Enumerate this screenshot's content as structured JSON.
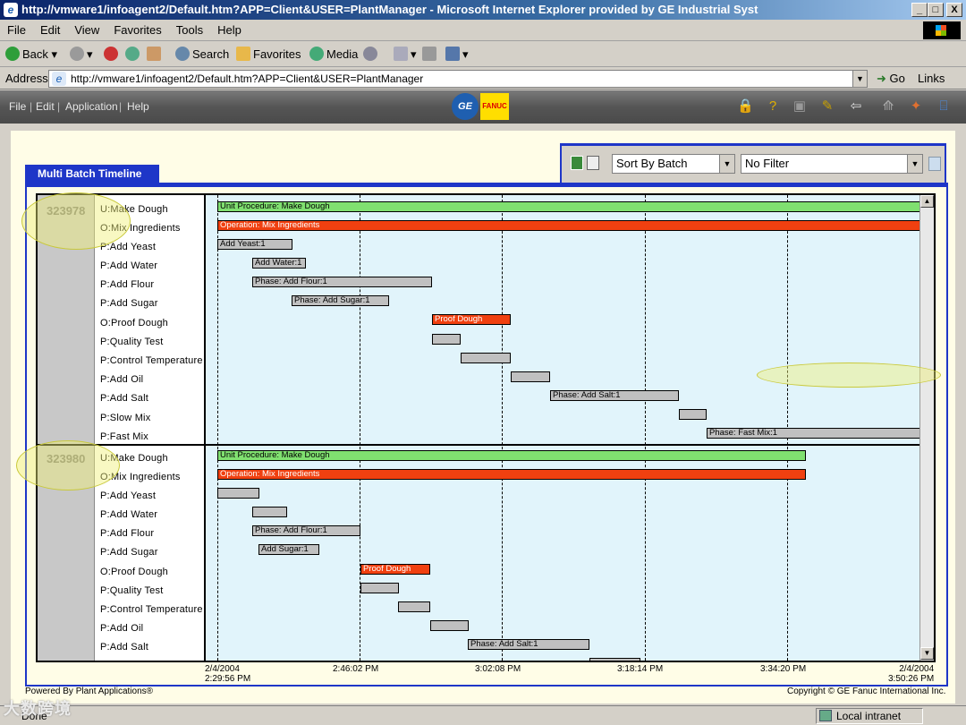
{
  "window": {
    "title": "http://vmware1/infoagent2/Default.htm?APP=Client&USER=PlantManager - Microsoft Internet Explorer provided by GE Industrial Syst",
    "minimize": "_",
    "maximize": "□",
    "close": "X"
  },
  "menu": [
    "File",
    "Edit",
    "View",
    "Favorites",
    "Tools",
    "Help"
  ],
  "toolbar": {
    "back": "Back",
    "search": "Search",
    "favorites": "Favorites",
    "media": "Media"
  },
  "address": {
    "label": "Address",
    "url": "http://vmware1/infoagent2/Default.htm?APP=Client&USER=PlantManager",
    "go": "Go",
    "links": "Links"
  },
  "appmenu": [
    "File",
    "Edit",
    "Application",
    "Help"
  ],
  "logos": {
    "ge": "GE",
    "fanuc": "FANUC"
  },
  "controls": {
    "sort": "Sort By Batch",
    "filter": "No Filter"
  },
  "tab": "Multi Batch Timeline",
  "batches": [
    {
      "id": "323978",
      "rows": [
        "U:Make Dough",
        "O:Mix Ingredients",
        "P:Add Yeast",
        "P:Add Water",
        "P:Add Flour",
        "P:Add Sugar",
        "O:Proof Dough",
        "P:Quality Test",
        "P:Control Temperature",
        "P:Add Oil",
        "P:Add Salt",
        "P:Slow Mix",
        "P:Fast Mix"
      ]
    },
    {
      "id": "323980",
      "rows": [
        "U:Make Dough",
        "O:Mix Ingredients",
        "P:Add Yeast",
        "P:Add Water",
        "P:Add Flour",
        "P:Add Sugar",
        "O:Proof Dough",
        "P:Quality Test",
        "P:Control Temperature",
        "P:Add Oil",
        "P:Add Salt"
      ]
    }
  ],
  "bar_labels": {
    "unit": "Unit Procedure: Make Dough",
    "op_mix": "Operation: Mix Ingredients",
    "yeast1": "Add Yeast:1",
    "water1": "Add Water:1",
    "flour1": "Phase: Add Flour:1",
    "sugar1": "Phase: Add Sugar:1",
    "proof": "Proof Dough",
    "salt1": "Phase: Add Salt:1",
    "fastmix1": "Phase: Fast Mix:1",
    "sugar_b2": "Add Sugar:1"
  },
  "time_axis": [
    {
      "line1": "2/4/2004",
      "line2": "2:29:56 PM"
    },
    {
      "line1": "2:46:02 PM",
      "line2": ""
    },
    {
      "line1": "3:02:08 PM",
      "line2": ""
    },
    {
      "line1": "3:18:14 PM",
      "line2": ""
    },
    {
      "line1": "3:34:20 PM",
      "line2": ""
    },
    {
      "line1": "2/4/2004",
      "line2": "3:50:26 PM"
    }
  ],
  "footer": {
    "left": "Powered By Plant Applications®",
    "right": "Copyright © GE Fanuc International Inc."
  },
  "status": {
    "text": "Done",
    "zone": "Local intranet"
  },
  "watermark": "大数跨境"
}
